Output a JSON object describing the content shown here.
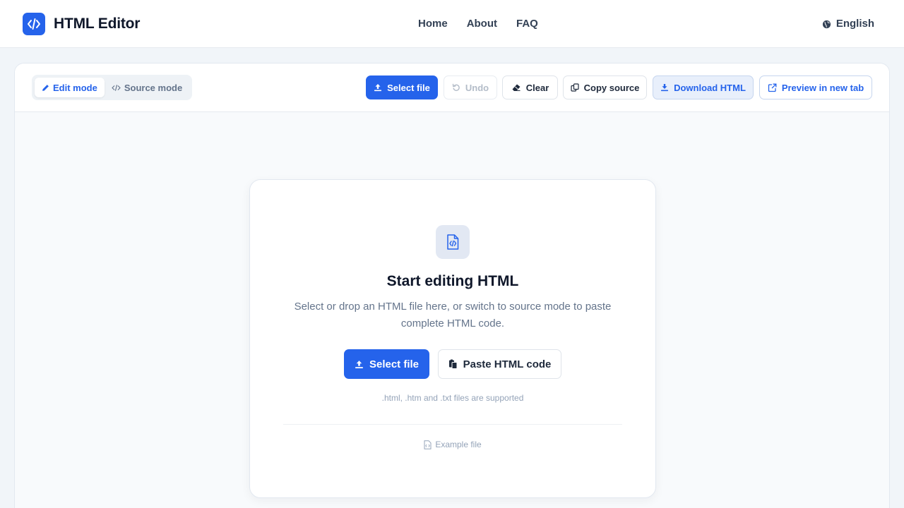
{
  "header": {
    "brand_name": "HTML Editor",
    "nav": [
      {
        "label": "Home"
      },
      {
        "label": "About"
      },
      {
        "label": "FAQ"
      }
    ],
    "language": "English"
  },
  "toolbar": {
    "modes": [
      {
        "label": "Edit mode",
        "active": true
      },
      {
        "label": "Source mode",
        "active": false
      }
    ],
    "select_file": "Select file",
    "undo": "Undo",
    "clear": "Clear",
    "copy_source": "Copy source",
    "download_html": "Download HTML",
    "preview": "Preview in new tab"
  },
  "empty_state": {
    "title": "Start editing HTML",
    "description": "Select or drop an HTML file here, or switch to source mode to paste complete HTML code.",
    "select_file": "Select file",
    "paste_code": "Paste HTML code",
    "supported": ".html, .htm and .txt files are supported",
    "example": "Example file"
  },
  "colors": {
    "accent": "#2563eb",
    "background": "#f1f5f9",
    "text": "#0f172a",
    "muted": "#64748b"
  }
}
